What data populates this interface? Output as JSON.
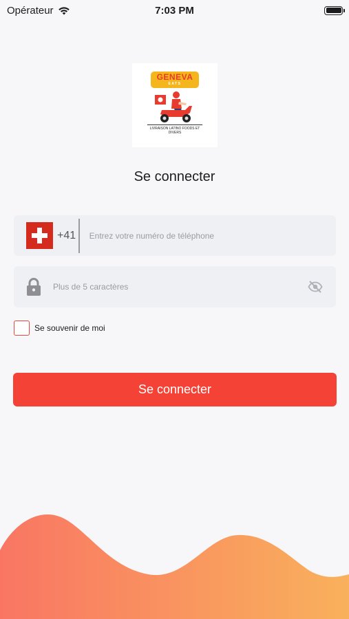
{
  "status_bar": {
    "carrier": "Opérateur",
    "time": "7:03 PM"
  },
  "logo": {
    "brand": "GENEVA",
    "sub": "EATS",
    "tagline": "LIVRAISON LATINO FOODS ET DIVERS"
  },
  "title": "Se connecter",
  "phone": {
    "country_code": "+41",
    "placeholder": "Entrez votre numéro de téléphone",
    "value": ""
  },
  "password": {
    "placeholder": "Plus de 5 caractères",
    "value": ""
  },
  "remember_label": "Se souvenir de moi",
  "remember_checked": false,
  "login_button": "Se connecter",
  "colors": {
    "accent": "#f44336",
    "field_bg": "#eff0f4",
    "wave_start": "#f97663",
    "wave_end": "#f9b15c"
  }
}
